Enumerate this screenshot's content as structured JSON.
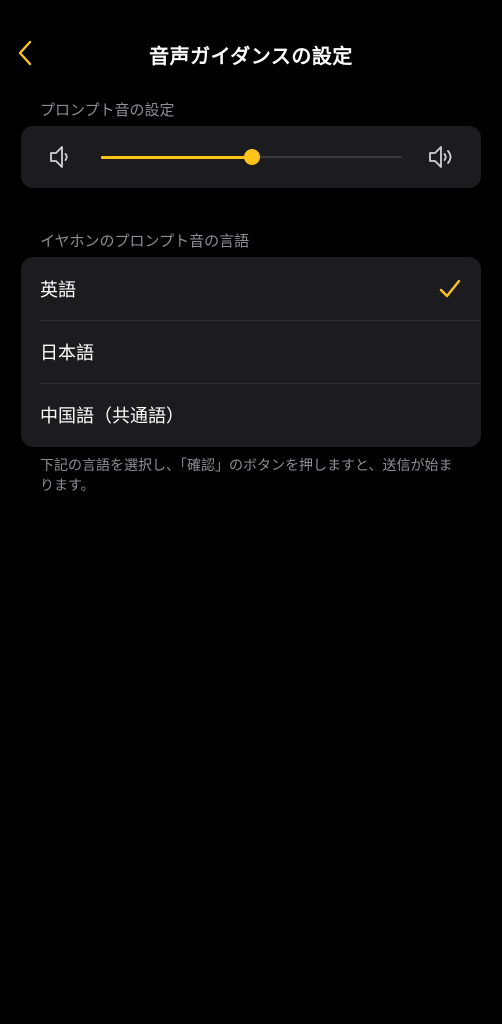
{
  "header": {
    "title": "音声ガイダンスの設定",
    "back_icon": "chevron-left-icon"
  },
  "prompt_volume": {
    "section_label": "プロンプト音の設定",
    "low_icon": "volume-low-icon",
    "high_icon": "volume-high-icon",
    "value_fraction": 0.5
  },
  "language": {
    "section_label": "イヤホンのプロンプト音の言語",
    "options": [
      {
        "label": "英語",
        "selected": true
      },
      {
        "label": "日本語",
        "selected": false
      },
      {
        "label": "中国語（共通語）",
        "selected": false
      }
    ],
    "check_icon": "checkmark-icon",
    "note": "下記の言語を選択し、「確認」のボタンを押しますと、送信が始まります。"
  },
  "colors": {
    "background": "#000000",
    "card": "#1c1c1e",
    "accent": "#fcc419",
    "secondary_text": "#8e8e93"
  }
}
